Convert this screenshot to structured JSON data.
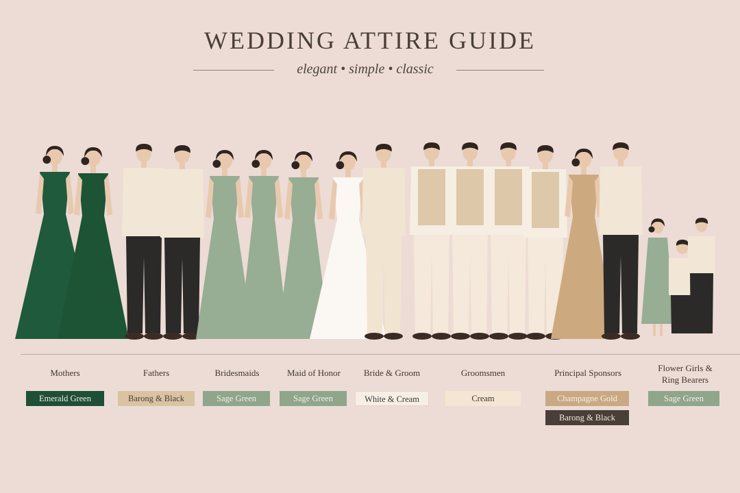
{
  "header": {
    "title": "WEDDING ATTIRE GUIDE",
    "subtitle": "elegant • simple • classic"
  },
  "groups": [
    {
      "label": "Mothers",
      "swatches": [
        {
          "text": "Emerald Green",
          "color": "#1f4f36",
          "text_color": "#f2ece4"
        }
      ]
    },
    {
      "label": "Fathers",
      "swatches": [
        {
          "text": "Barong & Black",
          "color": "#d9c3a3",
          "text_color": "#4a3e37"
        }
      ]
    },
    {
      "label": "Bridesmaids",
      "swatches": [
        {
          "text": "Sage Green",
          "color": "#8fa58c",
          "text_color": "#f4efe7"
        }
      ]
    },
    {
      "label": "Maid of Honor",
      "swatches": [
        {
          "text": "Sage Green",
          "color": "#8fa58c",
          "text_color": "#f4efe7"
        }
      ]
    },
    {
      "label": "Bride & Groom",
      "swatches": [
        {
          "text": "White & Cream",
          "color": "#f6efe6",
          "text_color": "#3f3631"
        }
      ]
    },
    {
      "label": "Groomsmen",
      "swatches": [
        {
          "text": "Cream",
          "color": "#f4e6d3",
          "text_color": "#3f3631"
        }
      ]
    },
    {
      "label": "Principal Sponsors",
      "swatches": [
        {
          "text": "Champagne Gold",
          "color": "#c9a983",
          "text_color": "#f6efe6"
        },
        {
          "text": "Barong & Black",
          "color": "#4a3e38",
          "text_color": "#f1e8dd"
        }
      ]
    },
    {
      "label": "Flower Girls & Ring Bearers",
      "label_lines": [
        "Flower Girls &",
        "Ring Bearers"
      ],
      "swatches": [
        {
          "text": "Sage Green",
          "color": "#8fa58c",
          "text_color": "#f4efe7"
        }
      ]
    }
  ],
  "palette": {
    "background": "#ecdcd5",
    "emerald": "#1f5a3c",
    "sage": "#97ad94",
    "cream": "#f2e6d6",
    "vest": "#ddc8aa",
    "champagne": "#cda97f",
    "black_trouser": "#2c2a28",
    "skin": "#e8c9ae",
    "hair": "#2f2420"
  }
}
